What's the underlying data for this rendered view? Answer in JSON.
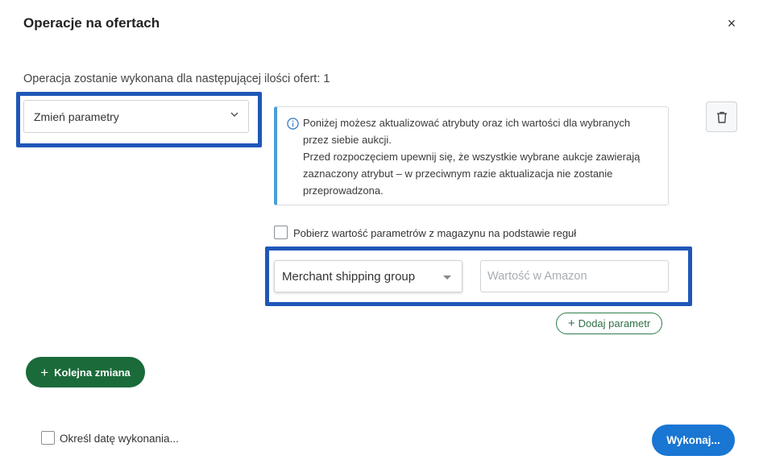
{
  "dialog": {
    "title": "Operacje na ofertach",
    "close_icon": "×",
    "count_text": "Operacja zostanie wykonana dla następującej ilości ofert: 1"
  },
  "operation": {
    "selected": "Zmień parametry"
  },
  "info_box": {
    "line1": "Poniżej możesz aktualizować atrybuty oraz ich wartości dla wybranych przez siebie aukcji.",
    "line2": "Przed rozpoczęciem upewnij się, że wszystkie wybrane aukcje zawierają zaznaczony atrybut – w przeciwnym razie aktualizacja nie zostanie przeprowadzona."
  },
  "stock_rules": {
    "label": "Pobierz wartość parametrów z magazynu na podstawie reguł",
    "checked": false
  },
  "parameter": {
    "selected": "Merchant shipping group",
    "value": "",
    "value_placeholder": "Wartość w Amazon",
    "add_label": "Dodaj parametr"
  },
  "actions": {
    "next_change_label": "Kolejna zmiana",
    "schedule_label": "Określ datę wykonania...",
    "schedule_checked": false,
    "execute_label": "Wykonaj..."
  },
  "colors": {
    "highlight": "#1f57b8",
    "primary_green": "#1b6b3a",
    "primary_blue": "#1976d2",
    "info_accent": "#4a9ed8"
  },
  "icons": {
    "close": "close-icon",
    "chevron": "chevron-down-icon",
    "info": "info-icon",
    "trash": "trash-icon",
    "plus": "plus-icon"
  }
}
